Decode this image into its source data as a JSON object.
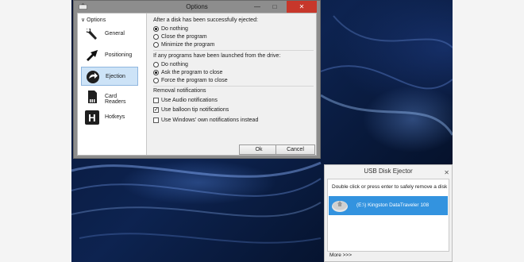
{
  "options_window": {
    "title": "Options",
    "controls": {
      "minimize": "—",
      "maximize": "□",
      "close": "✕"
    },
    "nav": {
      "header": "Options",
      "items": [
        {
          "label": "General",
          "icon": "wrench-icon",
          "selected": false
        },
        {
          "label": "Positioning",
          "icon": "cursor-arrow-icon",
          "selected": false
        },
        {
          "label": "Ejection",
          "icon": "eject-arrow-icon",
          "selected": true
        },
        {
          "label": "Card Readers",
          "icon": "memory-card-icon",
          "selected": false
        },
        {
          "label": "Hotkeys",
          "icon": "hotkey-h-icon",
          "selected": false
        }
      ]
    },
    "after_eject": {
      "title": "After a disk has been successfully ejected:",
      "options": [
        "Do nothing",
        "Close the program",
        "Minimize the program"
      ],
      "selected": 0
    },
    "programs_launched": {
      "title": "If any programs have been launched from the drive:",
      "options": [
        "Do nothing",
        "Ask the program to close",
        "Force the program to close"
      ],
      "selected": 1
    },
    "removal_notifications": {
      "title": "Removal notifications",
      "options": [
        {
          "label": "Use Audio notifications",
          "checked": false
        },
        {
          "label": "Use balloon tip notifications",
          "checked": true
        },
        {
          "label": "Use Windows' own notifications instead",
          "checked": false
        }
      ]
    },
    "buttons": {
      "ok": "Ok",
      "cancel": "Cancel"
    }
  },
  "usb_window": {
    "title": "USB Disk Ejector",
    "close": "✕",
    "hint": "Double click or press enter to safely remove a disk",
    "disk_label": "(E:\\) Kingston DataTraveler 108",
    "more": "More >>>"
  },
  "colors": {
    "titlebar": "#8d8d8d",
    "close_red": "#c7372b",
    "selection_blue": "#3393df",
    "nav_selected": "#cde3f7"
  }
}
